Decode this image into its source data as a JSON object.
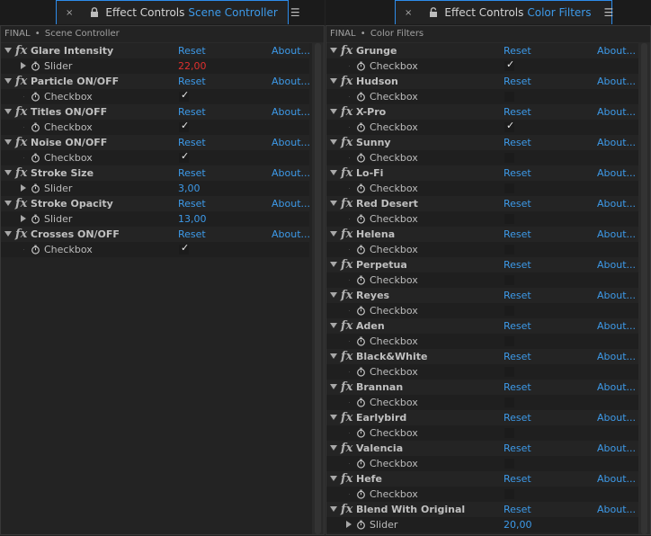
{
  "left_panel": {
    "tab": {
      "close": "×",
      "title": "Effect Controls",
      "comp": "Scene Controller",
      "swatch_color": "#e84fc4",
      "menu": "☰"
    },
    "header": {
      "comp": "FINAL",
      "sep": "•",
      "layer": "Scene Controller"
    },
    "effects": [
      {
        "name": "Glare Intensity",
        "reset": "Reset",
        "about": "About...",
        "param": {
          "type": "slider",
          "name": "Slider",
          "value": "22,00",
          "value_color": "red"
        }
      },
      {
        "name": "Particle ON/OFF",
        "reset": "Reset",
        "about": "About...",
        "param": {
          "type": "checkbox",
          "name": "Checkbox",
          "checked": true
        }
      },
      {
        "name": "Titles ON/OFF",
        "reset": "Reset",
        "about": "About...",
        "param": {
          "type": "checkbox",
          "name": "Checkbox",
          "checked": true
        }
      },
      {
        "name": "Noise ON/OFF",
        "reset": "Reset",
        "about": "About...",
        "param": {
          "type": "checkbox",
          "name": "Checkbox",
          "checked": true
        }
      },
      {
        "name": "Stroke Size",
        "reset": "Reset",
        "about": "About...",
        "param": {
          "type": "slider",
          "name": "Slider",
          "value": "3,00",
          "value_color": "blue"
        }
      },
      {
        "name": "Stroke Opacity",
        "reset": "Reset",
        "about": "About...",
        "param": {
          "type": "slider",
          "name": "Slider",
          "value": "13,00",
          "value_color": "blue"
        }
      },
      {
        "name": "Crosses ON/OFF",
        "reset": "Reset",
        "about": "About...",
        "param": {
          "type": "checkbox",
          "name": "Checkbox",
          "checked": true
        }
      }
    ]
  },
  "right_panel": {
    "tab": {
      "close": "×",
      "title": "Effect Controls",
      "comp": "Color Filters",
      "swatch_color": "#a7a4d6",
      "menu": "☰"
    },
    "header": {
      "comp": "FINAL",
      "sep": "•",
      "layer": "Color Filters"
    },
    "effects": [
      {
        "name": "Grunge",
        "reset": "Reset",
        "about": "About...",
        "param": {
          "type": "checkbox",
          "name": "Checkbox",
          "checked": true
        }
      },
      {
        "name": "Hudson",
        "reset": "Reset",
        "about": "About...",
        "param": {
          "type": "checkbox",
          "name": "Checkbox",
          "checked": false
        }
      },
      {
        "name": "X-Pro",
        "reset": "Reset",
        "about": "About...",
        "param": {
          "type": "checkbox",
          "name": "Checkbox",
          "checked": true
        }
      },
      {
        "name": "Sunny",
        "reset": "Reset",
        "about": "About...",
        "param": {
          "type": "checkbox",
          "name": "Checkbox",
          "checked": false
        }
      },
      {
        "name": "Lo-Fi",
        "reset": "Reset",
        "about": "About...",
        "param": {
          "type": "checkbox",
          "name": "Checkbox",
          "checked": false
        }
      },
      {
        "name": "Red Desert",
        "reset": "Reset",
        "about": "About...",
        "param": {
          "type": "checkbox",
          "name": "Checkbox",
          "checked": false
        }
      },
      {
        "name": "Helena",
        "reset": "Reset",
        "about": "About...",
        "param": {
          "type": "checkbox",
          "name": "Checkbox",
          "checked": false
        }
      },
      {
        "name": "Perpetua",
        "reset": "Reset",
        "about": "About...",
        "param": {
          "type": "checkbox",
          "name": "Checkbox",
          "checked": false
        }
      },
      {
        "name": "Reyes",
        "reset": "Reset",
        "about": "About...",
        "param": {
          "type": "checkbox",
          "name": "Checkbox",
          "checked": false
        }
      },
      {
        "name": "Aden",
        "reset": "Reset",
        "about": "About...",
        "param": {
          "type": "checkbox",
          "name": "Checkbox",
          "checked": false
        }
      },
      {
        "name": "Black&White",
        "reset": "Reset",
        "about": "About...",
        "param": {
          "type": "checkbox",
          "name": "Checkbox",
          "checked": false
        }
      },
      {
        "name": "Brannan",
        "reset": "Reset",
        "about": "About...",
        "param": {
          "type": "checkbox",
          "name": "Checkbox",
          "checked": false
        }
      },
      {
        "name": "Earlybird",
        "reset": "Reset",
        "about": "About...",
        "param": {
          "type": "checkbox",
          "name": "Checkbox",
          "checked": false
        }
      },
      {
        "name": "Valencia",
        "reset": "Reset",
        "about": "About...",
        "param": {
          "type": "checkbox",
          "name": "Checkbox",
          "checked": false
        }
      },
      {
        "name": "Hefe",
        "reset": "Reset",
        "about": "About...",
        "param": {
          "type": "checkbox",
          "name": "Checkbox",
          "checked": false
        }
      },
      {
        "name": "Blend With Original",
        "reset": "Reset",
        "about": "About...",
        "param": {
          "type": "slider",
          "name": "Slider",
          "value": "20,00",
          "value_color": "blue"
        }
      }
    ]
  },
  "colors": {
    "accent": "#3d9ae9",
    "value_red": "#e0302e",
    "panel_bg": "#232323"
  },
  "icons": {
    "lock": "lock-icon",
    "stopwatch": "stopwatch-icon",
    "fx": "fx-icon",
    "menu": "hamburger-menu-icon"
  },
  "fx_glyph": "fx",
  "checkmark": "✓"
}
